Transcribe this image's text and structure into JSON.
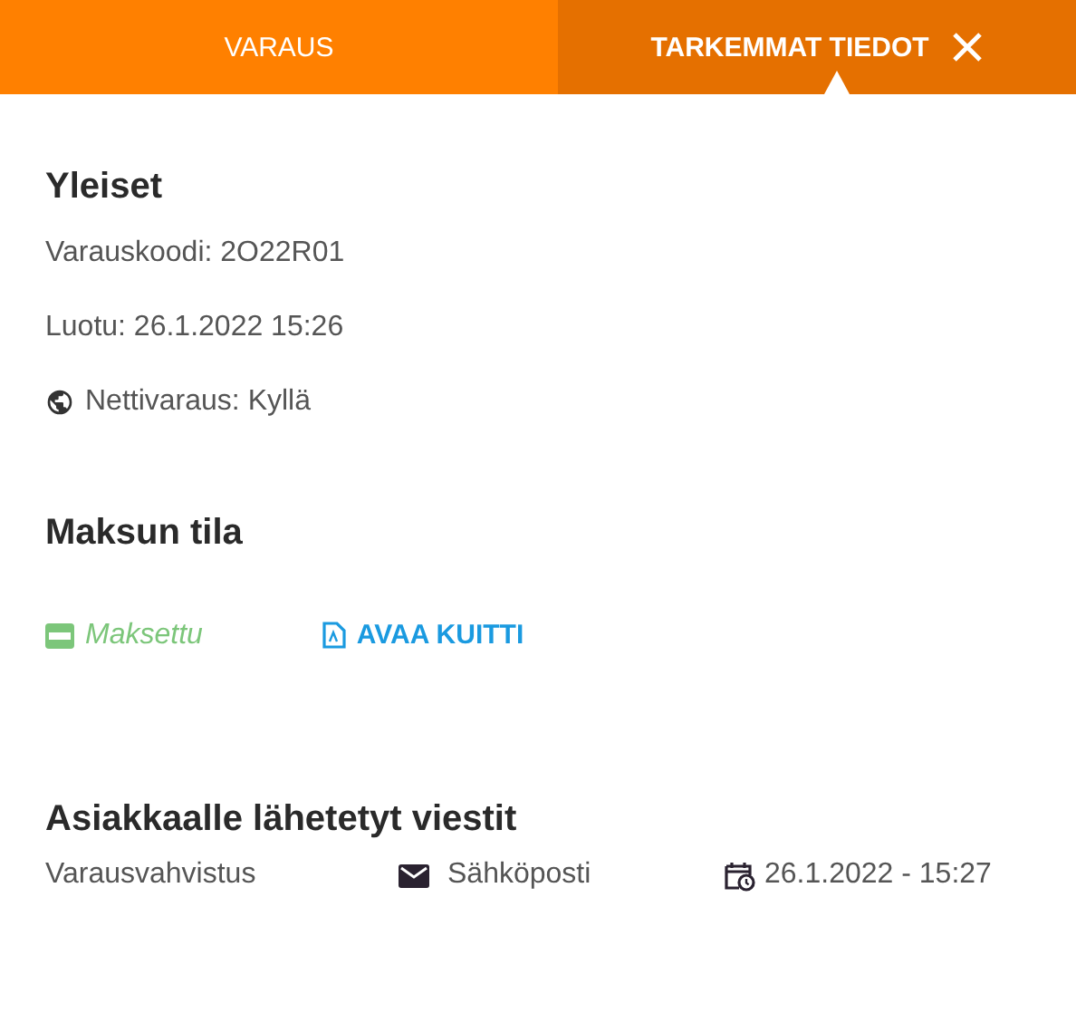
{
  "tabs": [
    {
      "label": "VARAUS",
      "selected": false
    },
    {
      "label": "TARKEMMAT TIEDOT",
      "selected": true
    }
  ],
  "general": {
    "title": "Yleiset",
    "booking_code": "Varauskoodi: 2O22R01",
    "created": "Luotu: 26.1.2022 15:26",
    "online_booking": "Nettivaraus: Kyllä"
  },
  "payment": {
    "title": "Maksun tila",
    "status": "Maksettu",
    "paid": true,
    "receipt_link": "AVAA KUITTI"
  },
  "messages": {
    "title": "Asiakkaalle lähetetyt viestit",
    "rows": [
      {
        "name": "Varausvahvistus",
        "channel": "Sähköposti",
        "sent": "26.1.2022 - 15:27"
      }
    ]
  }
}
